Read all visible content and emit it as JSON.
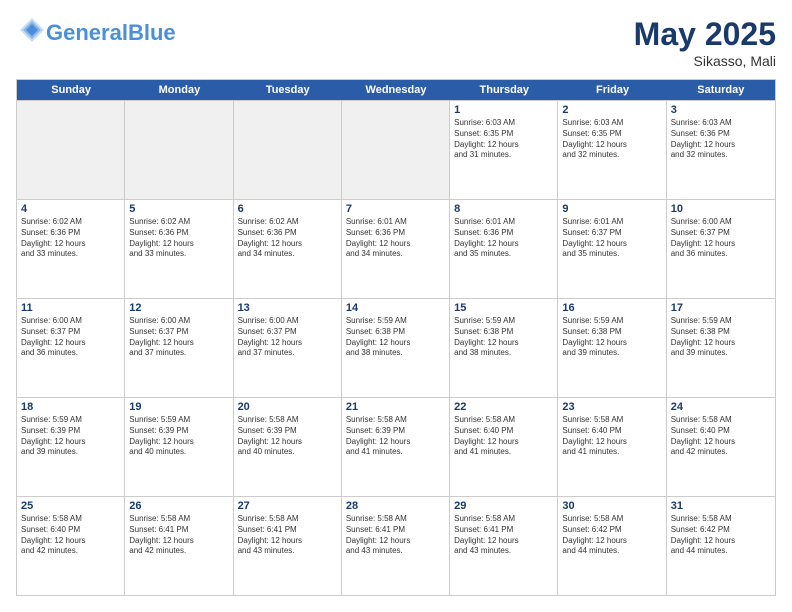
{
  "header": {
    "logo_main": "General",
    "logo_accent": "Blue",
    "month": "May 2025",
    "location": "Sikasso, Mali"
  },
  "days_of_week": [
    "Sunday",
    "Monday",
    "Tuesday",
    "Wednesday",
    "Thursday",
    "Friday",
    "Saturday"
  ],
  "weeks": [
    [
      {
        "day": "",
        "text": "",
        "shaded": true
      },
      {
        "day": "",
        "text": "",
        "shaded": true
      },
      {
        "day": "",
        "text": "",
        "shaded": true
      },
      {
        "day": "",
        "text": "",
        "shaded": true
      },
      {
        "day": "1",
        "text": "Sunrise: 6:03 AM\nSunset: 6:35 PM\nDaylight: 12 hours\nand 31 minutes."
      },
      {
        "day": "2",
        "text": "Sunrise: 6:03 AM\nSunset: 6:35 PM\nDaylight: 12 hours\nand 32 minutes."
      },
      {
        "day": "3",
        "text": "Sunrise: 6:03 AM\nSunset: 6:36 PM\nDaylight: 12 hours\nand 32 minutes."
      }
    ],
    [
      {
        "day": "4",
        "text": "Sunrise: 6:02 AM\nSunset: 6:36 PM\nDaylight: 12 hours\nand 33 minutes."
      },
      {
        "day": "5",
        "text": "Sunrise: 6:02 AM\nSunset: 6:36 PM\nDaylight: 12 hours\nand 33 minutes."
      },
      {
        "day": "6",
        "text": "Sunrise: 6:02 AM\nSunset: 6:36 PM\nDaylight: 12 hours\nand 34 minutes."
      },
      {
        "day": "7",
        "text": "Sunrise: 6:01 AM\nSunset: 6:36 PM\nDaylight: 12 hours\nand 34 minutes."
      },
      {
        "day": "8",
        "text": "Sunrise: 6:01 AM\nSunset: 6:36 PM\nDaylight: 12 hours\nand 35 minutes."
      },
      {
        "day": "9",
        "text": "Sunrise: 6:01 AM\nSunset: 6:37 PM\nDaylight: 12 hours\nand 35 minutes."
      },
      {
        "day": "10",
        "text": "Sunrise: 6:00 AM\nSunset: 6:37 PM\nDaylight: 12 hours\nand 36 minutes."
      }
    ],
    [
      {
        "day": "11",
        "text": "Sunrise: 6:00 AM\nSunset: 6:37 PM\nDaylight: 12 hours\nand 36 minutes."
      },
      {
        "day": "12",
        "text": "Sunrise: 6:00 AM\nSunset: 6:37 PM\nDaylight: 12 hours\nand 37 minutes."
      },
      {
        "day": "13",
        "text": "Sunrise: 6:00 AM\nSunset: 6:37 PM\nDaylight: 12 hours\nand 37 minutes."
      },
      {
        "day": "14",
        "text": "Sunrise: 5:59 AM\nSunset: 6:38 PM\nDaylight: 12 hours\nand 38 minutes."
      },
      {
        "day": "15",
        "text": "Sunrise: 5:59 AM\nSunset: 6:38 PM\nDaylight: 12 hours\nand 38 minutes."
      },
      {
        "day": "16",
        "text": "Sunrise: 5:59 AM\nSunset: 6:38 PM\nDaylight: 12 hours\nand 39 minutes."
      },
      {
        "day": "17",
        "text": "Sunrise: 5:59 AM\nSunset: 6:38 PM\nDaylight: 12 hours\nand 39 minutes."
      }
    ],
    [
      {
        "day": "18",
        "text": "Sunrise: 5:59 AM\nSunset: 6:39 PM\nDaylight: 12 hours\nand 39 minutes."
      },
      {
        "day": "19",
        "text": "Sunrise: 5:59 AM\nSunset: 6:39 PM\nDaylight: 12 hours\nand 40 minutes."
      },
      {
        "day": "20",
        "text": "Sunrise: 5:58 AM\nSunset: 6:39 PM\nDaylight: 12 hours\nand 40 minutes."
      },
      {
        "day": "21",
        "text": "Sunrise: 5:58 AM\nSunset: 6:39 PM\nDaylight: 12 hours\nand 41 minutes."
      },
      {
        "day": "22",
        "text": "Sunrise: 5:58 AM\nSunset: 6:40 PM\nDaylight: 12 hours\nand 41 minutes."
      },
      {
        "day": "23",
        "text": "Sunrise: 5:58 AM\nSunset: 6:40 PM\nDaylight: 12 hours\nand 41 minutes."
      },
      {
        "day": "24",
        "text": "Sunrise: 5:58 AM\nSunset: 6:40 PM\nDaylight: 12 hours\nand 42 minutes."
      }
    ],
    [
      {
        "day": "25",
        "text": "Sunrise: 5:58 AM\nSunset: 6:40 PM\nDaylight: 12 hours\nand 42 minutes."
      },
      {
        "day": "26",
        "text": "Sunrise: 5:58 AM\nSunset: 6:41 PM\nDaylight: 12 hours\nand 42 minutes."
      },
      {
        "day": "27",
        "text": "Sunrise: 5:58 AM\nSunset: 6:41 PM\nDaylight: 12 hours\nand 43 minutes."
      },
      {
        "day": "28",
        "text": "Sunrise: 5:58 AM\nSunset: 6:41 PM\nDaylight: 12 hours\nand 43 minutes."
      },
      {
        "day": "29",
        "text": "Sunrise: 5:58 AM\nSunset: 6:41 PM\nDaylight: 12 hours\nand 43 minutes."
      },
      {
        "day": "30",
        "text": "Sunrise: 5:58 AM\nSunset: 6:42 PM\nDaylight: 12 hours\nand 44 minutes."
      },
      {
        "day": "31",
        "text": "Sunrise: 5:58 AM\nSunset: 6:42 PM\nDaylight: 12 hours\nand 44 minutes."
      }
    ]
  ]
}
